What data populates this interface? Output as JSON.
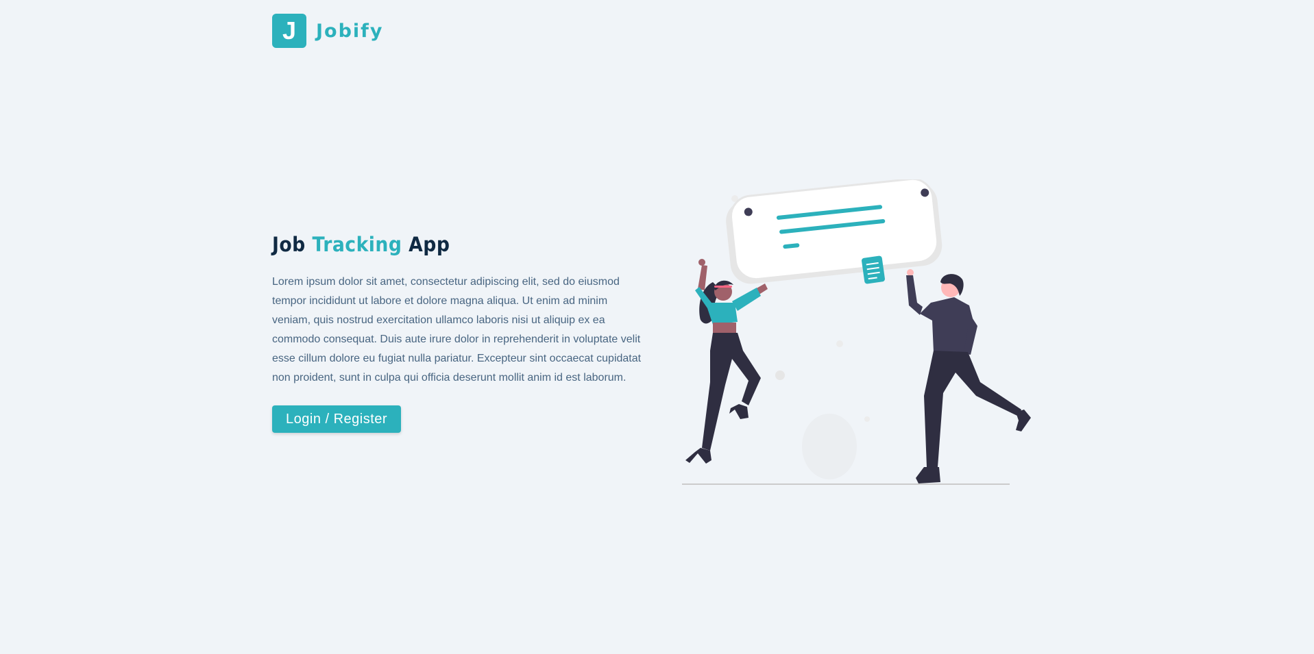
{
  "navbar": {
    "logo_letter": "J",
    "logo_text": "Jobify"
  },
  "hero": {
    "title_part1": "Job ",
    "title_accent": "Tracking",
    "title_part2": " App",
    "description": "Lorem ipsum dolor sit amet, consectetur adipiscing elit, sed do eiusmod tempor incididunt ut labore et dolore magna aliqua. Ut enim ad minim veniam, quis nostrud exercitation ullamco laboris nisi ut aliquip ex ea commodo consequat. Duis aute irure dolor in reprehenderit in voluptate velit esse cillum dolore eu fugiat nulla pariatur. Excepteur sint occaecat cupidatat non proident, sunt in culpa qui officia deserunt mollit anim id est laborum.",
    "button_label": "Login / Register"
  },
  "colors": {
    "background": "#f0f4f8",
    "primary": "#2cb1bc",
    "heading": "#102a43",
    "text": "#486581",
    "figure_dark": "#3f3d56",
    "pants_dark": "#2f2e41",
    "skin_dark": "#a0616a",
    "skin_light": "#ffb8b8"
  },
  "icons": {
    "logo": "logo-j-icon",
    "illustration": "job-board-people-illustration"
  }
}
